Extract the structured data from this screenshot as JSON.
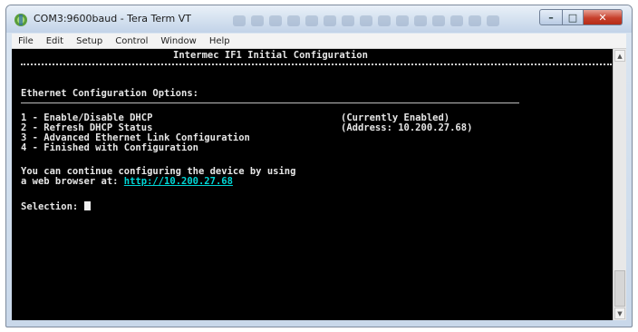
{
  "window": {
    "title": "COM3:9600baud - Tera Term VT",
    "controls": {
      "minimize": "–",
      "maximize": "□",
      "close": "✕"
    }
  },
  "menu": [
    "File",
    "Edit",
    "Setup",
    "Control",
    "Window",
    "Help"
  ],
  "terminal": {
    "heading": "Intermec IF1 Initial Configuration",
    "section": "Ethernet Configuration Options:",
    "options": [
      {
        "text": "1 - Enable/Disable DHCP",
        "status": "(Currently Enabled)"
      },
      {
        "text": "2 - Refresh DHCP Status",
        "status": "(Address: 10.200.27.68)"
      },
      {
        "text": "3 - Advanced Ethernet Link Configuration",
        "status": ""
      },
      {
        "text": "4 - Finished with Configuration",
        "status": ""
      }
    ],
    "info_line1": "You can continue configuring the device by using",
    "info_line2_prefix": "a web browser at: ",
    "info_link": "http://10.200.27.68",
    "prompt": "Selection: "
  },
  "colors": {
    "terminal_bg": "#000000",
    "terminal_fg": "#e6e6e6",
    "link": "#00d6d6",
    "close": "#c7402c"
  }
}
